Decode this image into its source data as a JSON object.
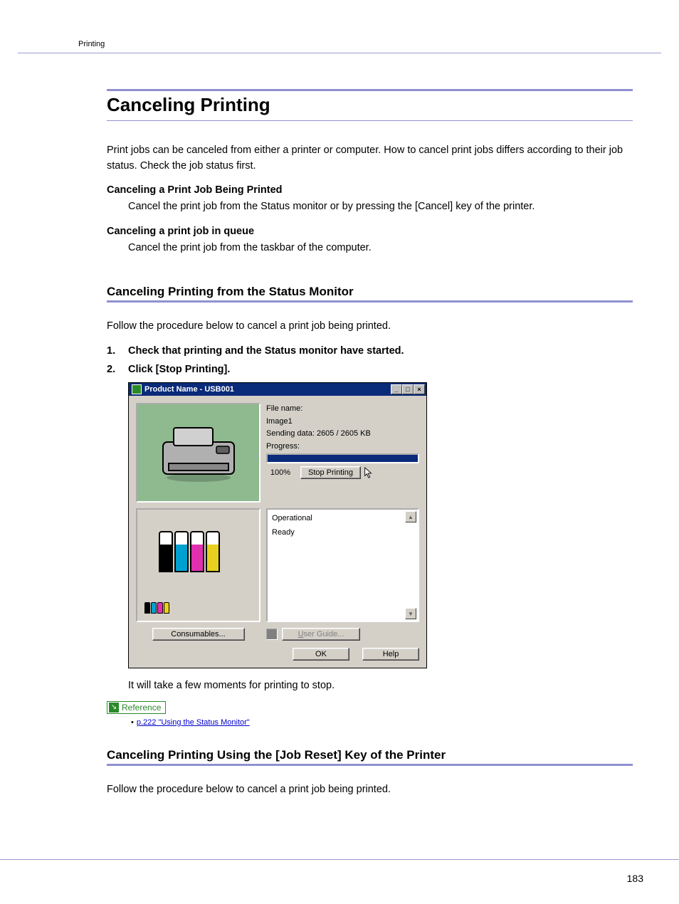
{
  "header": {
    "chapter": "Printing"
  },
  "footer": {
    "page": "183"
  },
  "heading_main": "Canceling Printing",
  "intro": "Print jobs can be canceled from either a printer or computer. How to cancel print jobs differs according to their job status. Check the job status first.",
  "block1": {
    "title": "Canceling a Print Job Being Printed",
    "body": "Cancel the print job from the Status monitor or by pressing the [Cancel] key of the printer."
  },
  "block2": {
    "title": "Canceling a print job in queue",
    "body": "Cancel the print job from the taskbar of the computer."
  },
  "section1": {
    "heading": "Canceling Printing from the Status Monitor",
    "lead": "Follow the procedure below to cancel a print job being printed.",
    "steps": [
      "Check that printing and the Status monitor have started.",
      "Click [Stop Printing]."
    ],
    "note_after": "It will take a few moments for printing to stop."
  },
  "reference": {
    "badge": "Reference",
    "link": "p.222 \"Using the Status Monitor\""
  },
  "section2": {
    "heading": "Canceling Printing Using the [Job Reset] Key of the Printer",
    "lead": "Follow the procedure below to cancel a print job being printed."
  },
  "dialog": {
    "title": "Product Name  - USB001",
    "file_label": "File name:",
    "file_value": "Image1",
    "sending": "Sending data: 2605 / 2605 KB",
    "progress_label": "Progress:",
    "progress_pct": "100%",
    "stop_btn": "Stop Printing",
    "status1": "Operational",
    "status2": "Ready",
    "consumables_btn": "Consumables...",
    "user_guide": "User Guide...",
    "ok": "OK",
    "help": "Help",
    "ink": [
      "#000000",
      "#00a0d0",
      "#e030b0",
      "#e8d020"
    ]
  }
}
